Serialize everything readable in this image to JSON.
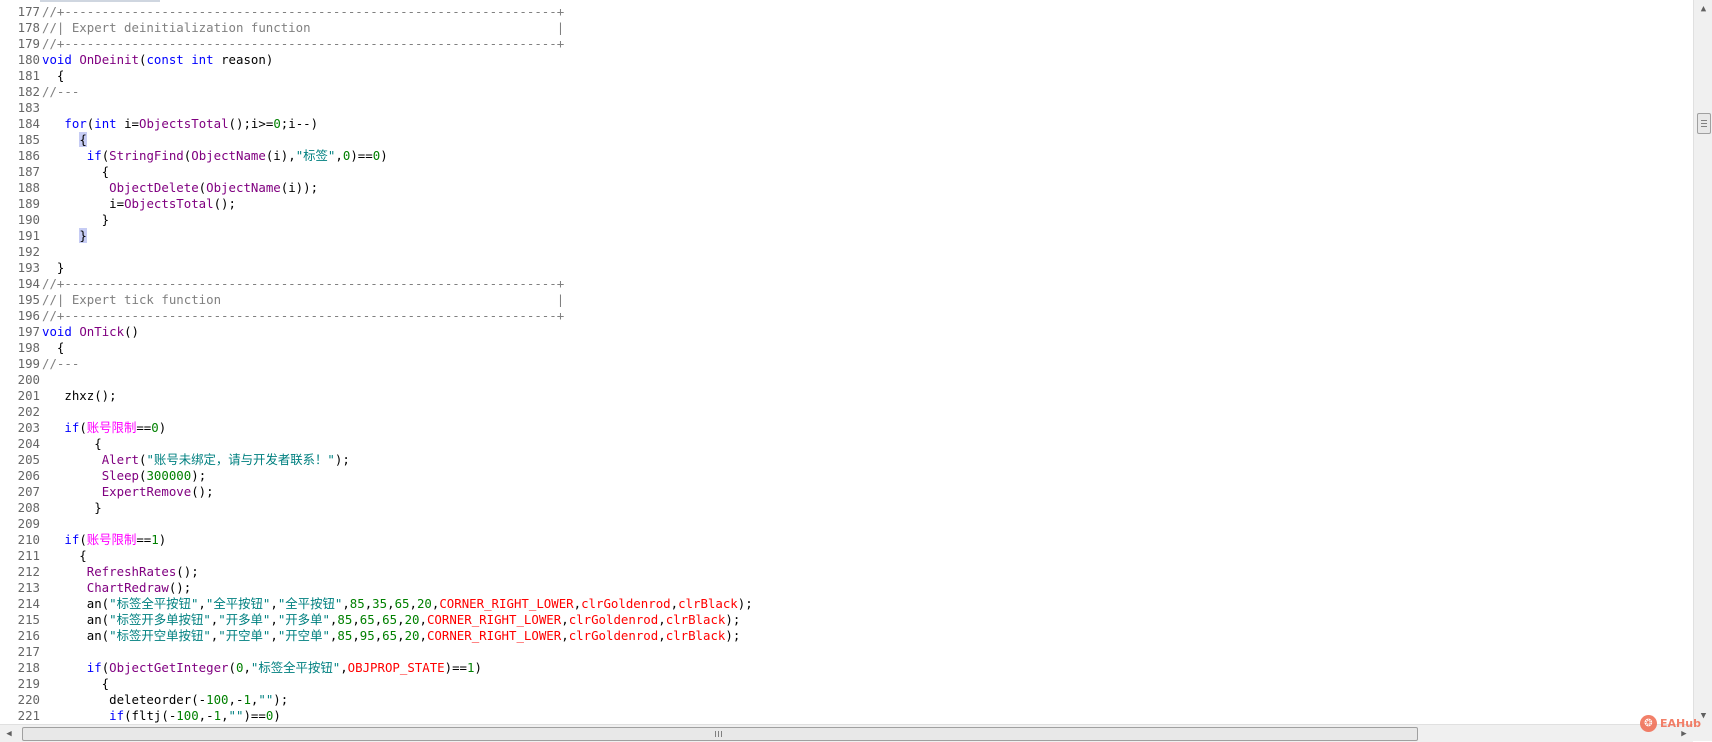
{
  "editor": {
    "lines": [
      {
        "n": "177",
        "segs": [
          [
            "comment",
            "//+------------------------------------------------------------------+"
          ]
        ]
      },
      {
        "n": "178",
        "segs": [
          [
            "comment",
            "//| Expert deinitialization function                                 |"
          ]
        ]
      },
      {
        "n": "179",
        "segs": [
          [
            "comment",
            "//+------------------------------------------------------------------+"
          ]
        ]
      },
      {
        "n": "180",
        "segs": [
          [
            "kw",
            "void "
          ],
          [
            "fn",
            "OnDeinit"
          ],
          [
            "txt",
            "("
          ],
          [
            "kw",
            "const int "
          ],
          [
            "txt",
            "reason)"
          ]
        ]
      },
      {
        "n": "181",
        "segs": [
          [
            "txt",
            "  {"
          ]
        ]
      },
      {
        "n": "182",
        "segs": [
          [
            "comment",
            "//---"
          ]
        ]
      },
      {
        "n": "183",
        "segs": []
      },
      {
        "n": "184",
        "segs": [
          [
            "txt",
            "   "
          ],
          [
            "kw",
            "for"
          ],
          [
            "txt",
            "("
          ],
          [
            "kw",
            "int "
          ],
          [
            "txt",
            "i="
          ],
          [
            "fn",
            "ObjectsTotal"
          ],
          [
            "txt",
            "();i>="
          ],
          [
            "num",
            "0"
          ],
          [
            "txt",
            ";i--)"
          ]
        ]
      },
      {
        "n": "185",
        "segs": [
          [
            "txt",
            "     "
          ],
          [
            "hl",
            "{"
          ]
        ]
      },
      {
        "n": "186",
        "segs": [
          [
            "txt",
            "      "
          ],
          [
            "kw",
            "if"
          ],
          [
            "txt",
            "("
          ],
          [
            "fn",
            "StringFind"
          ],
          [
            "txt",
            "("
          ],
          [
            "fn",
            "ObjectName"
          ],
          [
            "txt",
            "(i),"
          ],
          [
            "str",
            "\"标签\""
          ],
          [
            "txt",
            ","
          ],
          [
            "num",
            "0"
          ],
          [
            "txt",
            ")=="
          ],
          [
            "num",
            "0"
          ],
          [
            "txt",
            ")"
          ]
        ]
      },
      {
        "n": "187",
        "segs": [
          [
            "txt",
            "        {"
          ]
        ]
      },
      {
        "n": "188",
        "segs": [
          [
            "txt",
            "         "
          ],
          [
            "fn",
            "ObjectDelete"
          ],
          [
            "txt",
            "("
          ],
          [
            "fn",
            "ObjectName"
          ],
          [
            "txt",
            "(i));"
          ]
        ]
      },
      {
        "n": "189",
        "segs": [
          [
            "txt",
            "         i="
          ],
          [
            "fn",
            "ObjectsTotal"
          ],
          [
            "txt",
            "();"
          ]
        ]
      },
      {
        "n": "190",
        "segs": [
          [
            "txt",
            "        }"
          ]
        ]
      },
      {
        "n": "191",
        "segs": [
          [
            "txt",
            "     "
          ],
          [
            "hl",
            "}"
          ]
        ]
      },
      {
        "n": "192",
        "segs": []
      },
      {
        "n": "193",
        "segs": [
          [
            "txt",
            "  }"
          ]
        ]
      },
      {
        "n": "194",
        "segs": [
          [
            "comment",
            "//+------------------------------------------------------------------+"
          ]
        ]
      },
      {
        "n": "195",
        "segs": [
          [
            "comment",
            "//| Expert tick function                                             |"
          ]
        ]
      },
      {
        "n": "196",
        "segs": [
          [
            "comment",
            "//+------------------------------------------------------------------+"
          ]
        ]
      },
      {
        "n": "197",
        "segs": [
          [
            "kw",
            "void "
          ],
          [
            "fn",
            "OnTick"
          ],
          [
            "txt",
            "()"
          ]
        ]
      },
      {
        "n": "198",
        "segs": [
          [
            "txt",
            "  {"
          ]
        ]
      },
      {
        "n": "199",
        "segs": [
          [
            "comment",
            "//---"
          ]
        ]
      },
      {
        "n": "200",
        "segs": []
      },
      {
        "n": "201",
        "segs": [
          [
            "txt",
            "   zhxz();"
          ]
        ]
      },
      {
        "n": "202",
        "segs": []
      },
      {
        "n": "203",
        "segs": [
          [
            "txt",
            "   "
          ],
          [
            "kw",
            "if"
          ],
          [
            "txt",
            "("
          ],
          [
            "cjk",
            "账号限制"
          ],
          [
            "txt",
            "=="
          ],
          [
            "num",
            "0"
          ],
          [
            "txt",
            ")"
          ]
        ]
      },
      {
        "n": "204",
        "segs": [
          [
            "txt",
            "       {"
          ]
        ]
      },
      {
        "n": "205",
        "segs": [
          [
            "txt",
            "        "
          ],
          [
            "fn",
            "Alert"
          ],
          [
            "txt",
            "("
          ],
          [
            "str",
            "\"账号未绑定，请与开发者联系！\""
          ],
          [
            "txt",
            ");"
          ]
        ]
      },
      {
        "n": "206",
        "segs": [
          [
            "txt",
            "        "
          ],
          [
            "fn",
            "Sleep"
          ],
          [
            "txt",
            "("
          ],
          [
            "num",
            "300000"
          ],
          [
            "txt",
            ");"
          ]
        ]
      },
      {
        "n": "207",
        "segs": [
          [
            "txt",
            "        "
          ],
          [
            "fn",
            "ExpertRemove"
          ],
          [
            "txt",
            "();"
          ]
        ]
      },
      {
        "n": "208",
        "segs": [
          [
            "txt",
            "       }"
          ]
        ]
      },
      {
        "n": "209",
        "segs": []
      },
      {
        "n": "210",
        "segs": [
          [
            "txt",
            "   "
          ],
          [
            "kw",
            "if"
          ],
          [
            "txt",
            "("
          ],
          [
            "cjk",
            "账号限制"
          ],
          [
            "txt",
            "=="
          ],
          [
            "num",
            "1"
          ],
          [
            "txt",
            ")"
          ]
        ]
      },
      {
        "n": "211",
        "segs": [
          [
            "txt",
            "     {"
          ]
        ]
      },
      {
        "n": "212",
        "segs": [
          [
            "txt",
            "      "
          ],
          [
            "fn",
            "RefreshRates"
          ],
          [
            "txt",
            "();"
          ]
        ]
      },
      {
        "n": "213",
        "segs": [
          [
            "txt",
            "      "
          ],
          [
            "fn",
            "ChartRedraw"
          ],
          [
            "txt",
            "();"
          ]
        ]
      },
      {
        "n": "214",
        "segs": [
          [
            "txt",
            "      an("
          ],
          [
            "str",
            "\"标签全平按钮\""
          ],
          [
            "txt",
            ","
          ],
          [
            "str",
            "\"全平按钮\""
          ],
          [
            "txt",
            ","
          ],
          [
            "str",
            "\"全平按钮\""
          ],
          [
            "txt",
            ","
          ],
          [
            "num",
            "85"
          ],
          [
            "txt",
            ","
          ],
          [
            "num",
            "35"
          ],
          [
            "txt",
            ","
          ],
          [
            "num",
            "65"
          ],
          [
            "txt",
            ","
          ],
          [
            "num",
            "20"
          ],
          [
            "txt",
            ","
          ],
          [
            "err",
            "CORNER_RIGHT_LOWER"
          ],
          [
            "txt",
            ","
          ],
          [
            "err",
            "clrGoldenrod"
          ],
          [
            "txt",
            ","
          ],
          [
            "err",
            "clrBlack"
          ],
          [
            "txt",
            ");"
          ]
        ]
      },
      {
        "n": "215",
        "segs": [
          [
            "txt",
            "      an("
          ],
          [
            "str",
            "\"标签开多单按钮\""
          ],
          [
            "txt",
            ","
          ],
          [
            "str",
            "\"开多单\""
          ],
          [
            "txt",
            ","
          ],
          [
            "str",
            "\"开多单\""
          ],
          [
            "txt",
            ","
          ],
          [
            "num",
            "85"
          ],
          [
            "txt",
            ","
          ],
          [
            "num",
            "65"
          ],
          [
            "txt",
            ","
          ],
          [
            "num",
            "65"
          ],
          [
            "txt",
            ","
          ],
          [
            "num",
            "20"
          ],
          [
            "txt",
            ","
          ],
          [
            "err",
            "CORNER_RIGHT_LOWER"
          ],
          [
            "txt",
            ","
          ],
          [
            "err",
            "clrGoldenrod"
          ],
          [
            "txt",
            ","
          ],
          [
            "err",
            "clrBlack"
          ],
          [
            "txt",
            ");"
          ]
        ]
      },
      {
        "n": "216",
        "segs": [
          [
            "txt",
            "      an("
          ],
          [
            "str",
            "\"标签开空单按钮\""
          ],
          [
            "txt",
            ","
          ],
          [
            "str",
            "\"开空单\""
          ],
          [
            "txt",
            ","
          ],
          [
            "str",
            "\"开空单\""
          ],
          [
            "txt",
            ","
          ],
          [
            "num",
            "85"
          ],
          [
            "txt",
            ","
          ],
          [
            "num",
            "95"
          ],
          [
            "txt",
            ","
          ],
          [
            "num",
            "65"
          ],
          [
            "txt",
            ","
          ],
          [
            "num",
            "20"
          ],
          [
            "txt",
            ","
          ],
          [
            "err",
            "CORNER_RIGHT_LOWER"
          ],
          [
            "txt",
            ","
          ],
          [
            "err",
            "clrGoldenrod"
          ],
          [
            "txt",
            ","
          ],
          [
            "err",
            "clrBlack"
          ],
          [
            "txt",
            ");"
          ]
        ]
      },
      {
        "n": "217",
        "segs": []
      },
      {
        "n": "218",
        "segs": [
          [
            "txt",
            "      "
          ],
          [
            "kw",
            "if"
          ],
          [
            "txt",
            "("
          ],
          [
            "fn",
            "ObjectGetInteger"
          ],
          [
            "txt",
            "("
          ],
          [
            "num",
            "0"
          ],
          [
            "txt",
            ","
          ],
          [
            "str",
            "\"标签全平按钮\""
          ],
          [
            "txt",
            ","
          ],
          [
            "err",
            "OBJPROP_STATE"
          ],
          [
            "txt",
            ")=="
          ],
          [
            "num",
            "1"
          ],
          [
            "txt",
            ")"
          ]
        ]
      },
      {
        "n": "219",
        "segs": [
          [
            "txt",
            "        {"
          ]
        ]
      },
      {
        "n": "220",
        "segs": [
          [
            "txt",
            "         deleteorder(-"
          ],
          [
            "num",
            "100"
          ],
          [
            "txt",
            ",-"
          ],
          [
            "num",
            "1"
          ],
          [
            "txt",
            ","
          ],
          [
            "str",
            "\"\""
          ],
          [
            "txt",
            ");"
          ]
        ]
      },
      {
        "n": "221",
        "segs": [
          [
            "txt",
            "         "
          ],
          [
            "kw",
            "if"
          ],
          [
            "txt",
            "(fltj(-"
          ],
          [
            "num",
            "100"
          ],
          [
            "txt",
            ",-"
          ],
          [
            "num",
            "1"
          ],
          [
            "txt",
            ","
          ],
          [
            "str",
            "\"\""
          ],
          [
            "txt",
            ")=="
          ],
          [
            "num",
            "0"
          ],
          [
            "txt",
            ")"
          ]
        ]
      }
    ]
  },
  "watermark": {
    "logo": "❂",
    "text": "EAHub"
  },
  "icons": {
    "arrow_up": "▲",
    "arrow_down": "▼",
    "arrow_left": "◀",
    "arrow_right": "▶"
  },
  "colors": {
    "keyword": "#0000ff",
    "function": "#800080",
    "number": "#008000",
    "string": "#008080",
    "constant": "#ff0000",
    "comment": "#808080",
    "identifier_cjk": "#ff00ff",
    "bracket_highlight": "#c6ccf4"
  }
}
